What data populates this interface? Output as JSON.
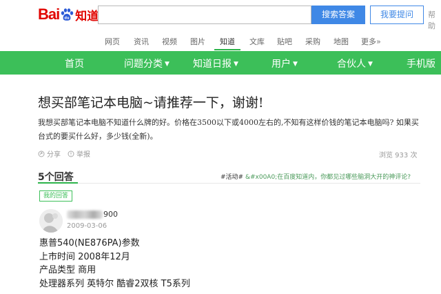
{
  "header": {
    "logo_text": "Bai",
    "logo_suffix": "知道",
    "search_placeholder": "",
    "search_button": "搜索答案",
    "ask_button": "我要提问",
    "help_link": "帮助"
  },
  "product_nav": {
    "items": [
      "网页",
      "资讯",
      "视频",
      "图片",
      "知道",
      "文库",
      "贴吧",
      "采购",
      "地图",
      "更多»"
    ],
    "active": "知道"
  },
  "green_nav": {
    "items": [
      "首页",
      "问题分类",
      "知道日报",
      "用户",
      "合伙人",
      "手机版"
    ]
  },
  "question": {
    "title": "想买部笔记本电脑~请推荐一下，谢谢!",
    "body_line1": "我想买部笔记本电脑不知道什么牌的好。价格在3500以下或4000左右的,不知有这样价钱的笔记本电脑吗? 如果买",
    "body_line2": "台式的要买什么好，多少钱(全新)。",
    "share_label": "分享",
    "report_label": "举报",
    "views": "浏览 933 次"
  },
  "answers": {
    "count_label": "5个回答",
    "promo_tag": "#活动#",
    "promo_text": " &#x00A0;在百度知道内，你都见过哪些脑洞大开的神评论?",
    "my_answer_label": "我的回答",
    "answerer": {
      "name_suffix": "900",
      "date": "2009-03-06"
    },
    "body_lines": [
      "惠普540(NE876PA)参数",
      "上市时间 2008年12月",
      "产品类型 商用",
      "处理器系列 英特尔 酷睿2双核 T5系列"
    ]
  },
  "colors": {
    "brand_red": "#e10602",
    "brand_blue": "#3f88e6",
    "nav_green": "#3cbf59"
  }
}
